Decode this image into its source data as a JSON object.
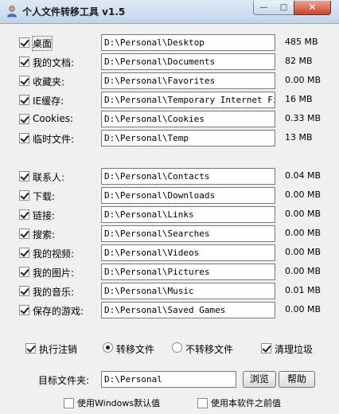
{
  "window": {
    "title": "个人文件转移工具 v1.5",
    "minimize_glyph": "—",
    "maximize_glyph": "□",
    "close_glyph": "✕"
  },
  "folders_group1": [
    {
      "label": "桌面",
      "path": "D:\\Personal\\Desktop",
      "size": "485 MB",
      "checked": true
    },
    {
      "label": "我的文档:",
      "path": "D:\\Personal\\Documents",
      "size": "82 MB",
      "checked": true
    },
    {
      "label": "收藏夹:",
      "path": "D:\\Personal\\Favorites",
      "size": "0.00 MB",
      "checked": true
    },
    {
      "label": "IE缓存:",
      "path": "D:\\Personal\\Temporary Internet Files",
      "size": "16 MB",
      "checked": true
    },
    {
      "label": "Cookies:",
      "path": "D:\\Personal\\Cookies",
      "size": "0.33 MB",
      "checked": true
    },
    {
      "label": "临时文件:",
      "path": "D:\\Personal\\Temp",
      "size": "13 MB",
      "checked": true
    }
  ],
  "folders_group2": [
    {
      "label": "联系人:",
      "path": "D:\\Personal\\Contacts",
      "size": "0.04 MB",
      "checked": true
    },
    {
      "label": "下载:",
      "path": "D:\\Personal\\Downloads",
      "size": "0.00 MB",
      "checked": true
    },
    {
      "label": "链接:",
      "path": "D:\\Personal\\Links",
      "size": "0.00 MB",
      "checked": true
    },
    {
      "label": "搜索:",
      "path": "D:\\Personal\\Searches",
      "size": "0.00 MB",
      "checked": true
    },
    {
      "label": "我的视频:",
      "path": "D:\\Personal\\Videos",
      "size": "0.00 MB",
      "checked": true
    },
    {
      "label": "我的图片:",
      "path": "D:\\Personal\\Pictures",
      "size": "0.00 MB",
      "checked": true
    },
    {
      "label": "我的音乐:",
      "path": "D:\\Personal\\Music",
      "size": "0.01 MB",
      "checked": true
    },
    {
      "label": "保存的游戏:",
      "path": "D:\\Personal\\Saved Games",
      "size": "0.00 MB",
      "checked": true
    }
  ],
  "options": {
    "execute_logoff_label": "执行注销",
    "execute_logoff_checked": true,
    "transfer_label": "转移文件",
    "no_transfer_label": "不转移文件",
    "transfer_selected": "transfer",
    "cleanup_label": "清理垃圾",
    "cleanup_checked": true
  },
  "target": {
    "label": "目标文件夹:",
    "path": "D:\\Personal",
    "browse_label": "浏览",
    "help_label": "帮助"
  },
  "bottom": {
    "windows_default_label": "使用Windows默认值",
    "previous_value_label": "使用本软件之前值"
  }
}
